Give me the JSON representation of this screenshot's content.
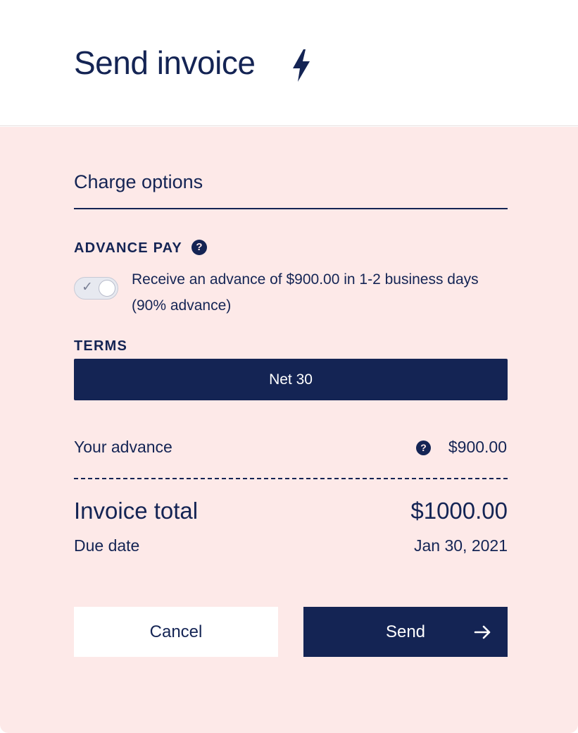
{
  "header": {
    "title": "Send invoice",
    "icon": "lightning-bolt-icon"
  },
  "charge_options": {
    "section_title": "Charge options",
    "advance_pay": {
      "label": "ADVANCE PAY",
      "help_icon": "?",
      "toggle_on": true,
      "description": "Receive an advance of $900.00 in 1-2 business days (90% advance)"
    },
    "terms": {
      "label": "TERMS",
      "selected": "Net 30"
    }
  },
  "summary": {
    "advance_label": "Your advance",
    "advance_help_icon": "?",
    "advance_value": "$900.00",
    "total_label": "Invoice total",
    "total_value": "$1000.00",
    "due_label": "Due date",
    "due_value": "Jan 30, 2021"
  },
  "actions": {
    "cancel_label": "Cancel",
    "send_label": "Send"
  },
  "colors": {
    "navy": "#142454",
    "panel_bg": "#fde9e8",
    "white": "#ffffff"
  }
}
